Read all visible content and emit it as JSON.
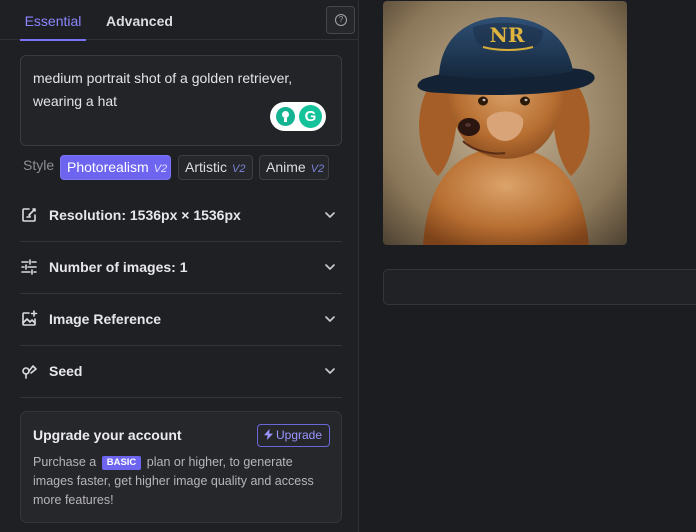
{
  "tabs": [
    {
      "label": "Essential",
      "active": true
    },
    {
      "label": "Advanced",
      "active": false
    }
  ],
  "help_icon": "question-circle-icon",
  "prompt": {
    "value": "medium portrait shot of a golden retriever, wearing a hat",
    "extension_icons": [
      "grammarly-lightbulb-icon",
      "grammarly-g-icon"
    ]
  },
  "style": {
    "label": "Style",
    "options": [
      {
        "name": "Photorealism",
        "version": "V2",
        "selected": true
      },
      {
        "name": "Artistic",
        "version": "V2",
        "selected": false
      },
      {
        "name": "Anime",
        "version": "V2",
        "selected": false
      }
    ]
  },
  "settings": [
    {
      "label": "Resolution: 1536px × 1536px",
      "icon": "resize-icon"
    },
    {
      "label": "Number of images: 1",
      "icon": "sliders-icon"
    },
    {
      "label": "Image Reference",
      "icon": "image-add-icon"
    },
    {
      "label": "Seed",
      "icon": "seed-icon"
    }
  ],
  "upgrade": {
    "title": "Upgrade your account",
    "button_label": "Upgrade",
    "text_before": "Purchase a",
    "badge": "BASIC",
    "text_after": "plan or higher, to generate images faster, get higher image quality and access more features!"
  },
  "generated_image": {
    "subject": "golden retriever wearing a navy cap",
    "hat_text": "NR"
  },
  "colors": {
    "accent": "#6d64f0",
    "background": "#1c1d21",
    "panel": "#1f2024"
  }
}
